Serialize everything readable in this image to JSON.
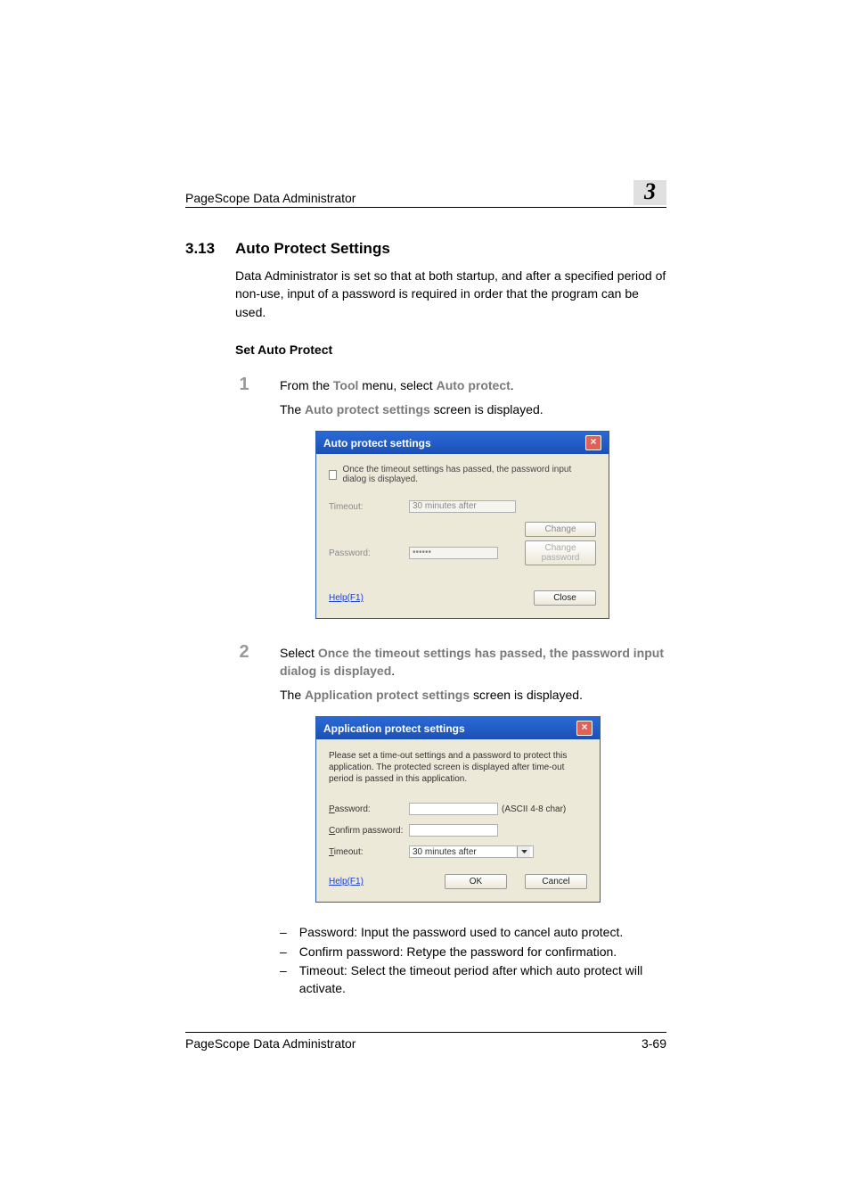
{
  "header": {
    "product": "PageScope Data Administrator",
    "chapter_num": "3"
  },
  "section": {
    "num": "3.13",
    "title": "Auto Protect Settings",
    "intro": "Data Administrator is set so that at both startup, and after a specified period of non-use, input of a password is required in order that the program can be used.",
    "subhead": "Set Auto Protect"
  },
  "step1": {
    "num": "1",
    "prefix": "From the ",
    "menu": "Tool",
    "mid": " menu, select ",
    "item": "Auto protect",
    "suffix": ".",
    "result_a": "The ",
    "result_b": "Auto protect settings",
    "result_c": " screen is displayed."
  },
  "dlg1": {
    "title": "Auto protect settings",
    "checkbox": "Once the timeout settings has passed, the password input dialog is displayed.",
    "timeout_label": "Timeout:",
    "timeout_value": "30 minutes after",
    "change_label": "Change",
    "password_label": "Password:",
    "password_value": "••••••",
    "chpw_label": "Change password",
    "help": "Help(F1)",
    "close": "Close"
  },
  "step2": {
    "num": "2",
    "prefix": "Select ",
    "bold": "Once the timeout settings has passed, the password input dialog is displayed",
    "suffix": ".",
    "result_a": "The ",
    "result_b": "Application protect settings",
    "result_c": " screen is displayed."
  },
  "dlg2": {
    "title": "Application protect settings",
    "msg": "Please set a time-out settings and a password to protect this application. The protected screen is displayed after time-out period is passed in this application.",
    "pw_label": "Password:",
    "pw_note": "(ASCII 4-8 char)",
    "confirm_label": "Confirm password:",
    "timeout_label": "Timeout:",
    "timeout_value": "30 minutes after",
    "help": "Help(F1)",
    "ok": "OK",
    "cancel": "Cancel"
  },
  "bullets": {
    "b1": "Password: Input the password used to cancel auto protect.",
    "b2": "Confirm password: Retype the password for confirmation.",
    "b3": "Timeout: Select the timeout period after which auto protect will activate."
  },
  "footer": {
    "product": "PageScope Data Administrator",
    "page": "3-69"
  }
}
